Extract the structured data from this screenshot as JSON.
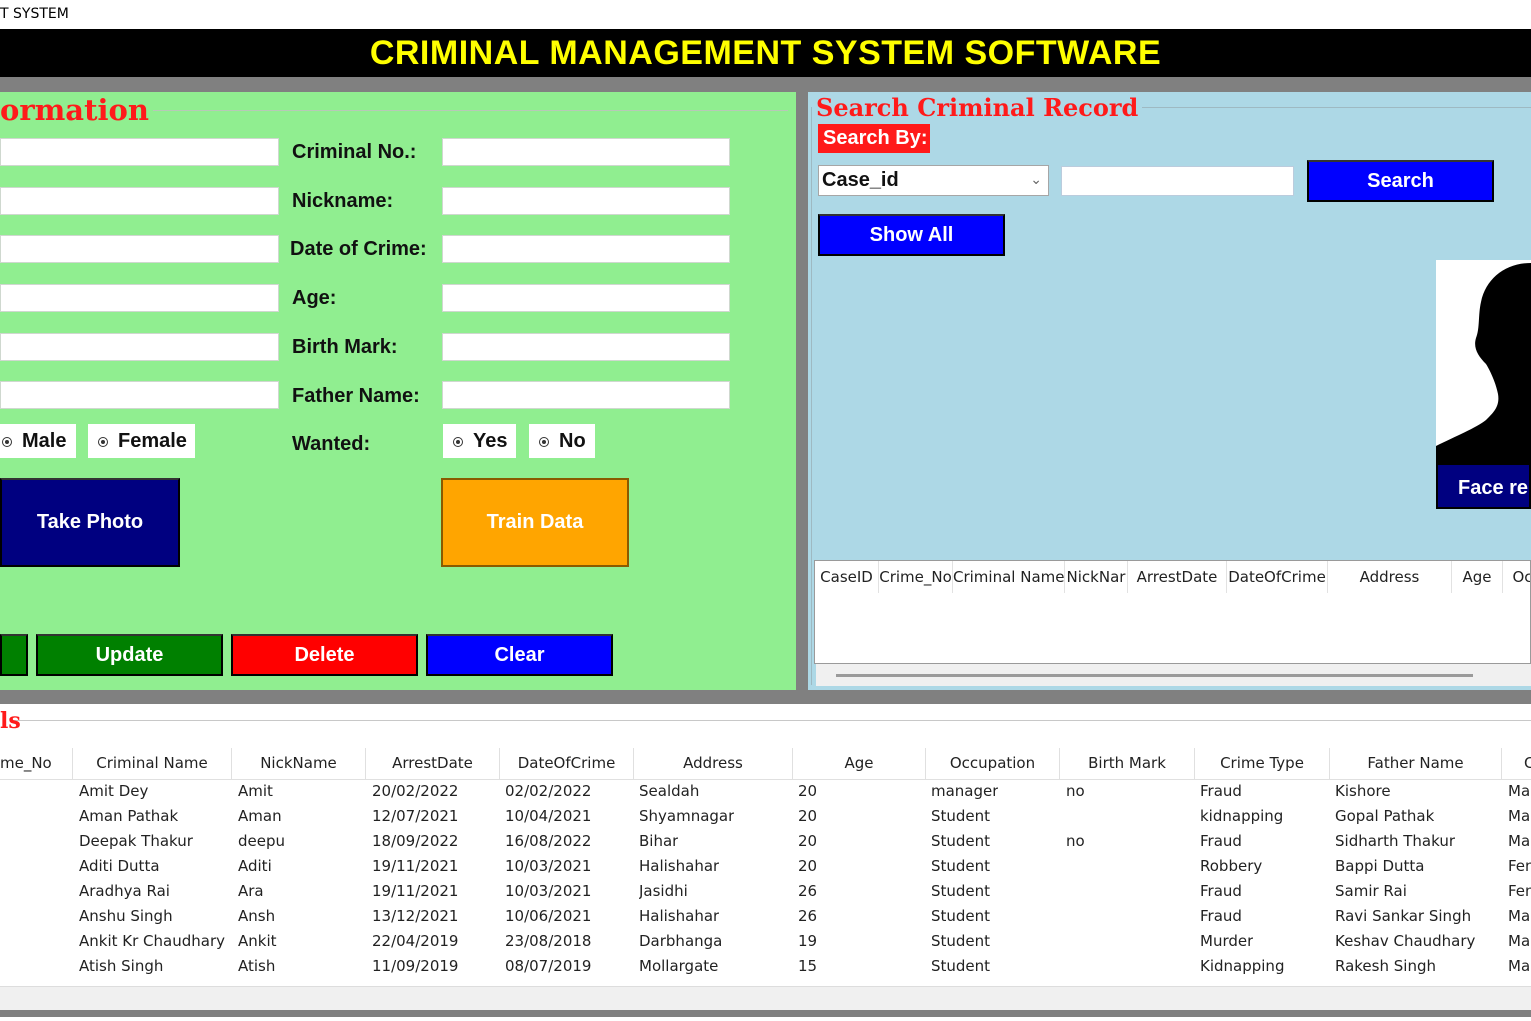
{
  "window": {
    "title": "T SYSTEM"
  },
  "banner": {
    "title": "CRIMINAL MANAGEMENT SYSTEM SOFTWARE"
  },
  "info_panel": {
    "legend": "ormation",
    "fields": {
      "criminal_no": "Criminal No.:",
      "nickname": "Nickname:",
      "date_of_crime": "Date of Crime:",
      "age": "Age:",
      "birth_mark": "Birth Mark:",
      "father_name": "Father Name:",
      "wanted": "Wanted:"
    },
    "gender": {
      "male": "Male",
      "female": "Female"
    },
    "wanted_opts": {
      "yes": "Yes",
      "no": "No"
    },
    "buttons": {
      "take_photo": "Take Photo",
      "train_data": "Train Data",
      "update": "Update",
      "delete": "Delete",
      "clear": "Clear"
    }
  },
  "search_panel": {
    "legend": "Search Criminal Record",
    "search_by": "Search By:",
    "combo_value": "Case_id",
    "search_button": "Search",
    "show_all_button": "Show All",
    "face_button": "Face re",
    "columns": [
      "CaseID",
      "Crime_No",
      "Criminal Name",
      "NickNar",
      "ArrestDate",
      "DateOfCrime",
      "Address",
      "Age",
      "Oc"
    ]
  },
  "details": {
    "legend": "ls",
    "columns": [
      "me_No",
      "Criminal Name",
      "NickName",
      "ArrestDate",
      "DateOfCrime",
      "Address",
      "Age",
      "Occupation",
      "Birth Mark",
      "Crime Type",
      "Father Name",
      "C"
    ],
    "rows": [
      [
        "",
        "Amit Dey",
        "Amit",
        "20/02/2022",
        "02/02/2022",
        "Sealdah",
        "20",
        "manager",
        "no",
        "Fraud",
        "Kishore",
        "Mal"
      ],
      [
        "",
        "Aman Pathak",
        "Aman",
        "12/07/2021",
        "10/04/2021",
        "Shyamnagar",
        "20",
        "Student",
        "",
        "kidnapping",
        "Gopal Pathak",
        "Mal"
      ],
      [
        "",
        "Deepak Thakur",
        "deepu",
        "18/09/2022",
        "16/08/2022",
        "Bihar",
        "20",
        "Student",
        "no",
        "Fraud",
        "Sidharth Thakur",
        "Mal"
      ],
      [
        "",
        "Aditi Dutta",
        "Aditi",
        "19/11/2021",
        "10/03/2021",
        "Halishahar",
        "20",
        "Student",
        "",
        "Robbery",
        "Bappi Dutta",
        "Fen"
      ],
      [
        "",
        "Aradhya Rai",
        "Ara",
        "19/11/2021",
        "10/03/2021",
        "Jasidhi",
        "26",
        "Student",
        "",
        "Fraud",
        "Samir Rai",
        "Fen"
      ],
      [
        "",
        "Anshu Singh",
        "Ansh",
        "13/12/2021",
        "10/06/2021",
        "Halishahar",
        "26",
        "Student",
        "",
        "Fraud",
        "Ravi Sankar Singh",
        "Mal"
      ],
      [
        "",
        "Ankit Kr Chaudhary",
        "Ankit",
        "22/04/2019",
        "23/08/2018",
        "Darbhanga",
        "19",
        "Student",
        "",
        "Murder",
        "Keshav Chaudhary",
        "Mal"
      ],
      [
        "",
        "Atish Singh",
        "Atish",
        "11/09/2019",
        "08/07/2019",
        "Mollargate",
        "15",
        "Student",
        "",
        "Kidnapping",
        "Rakesh Singh",
        "Mal"
      ]
    ]
  },
  "colors": {
    "banner_bg": "#000000",
    "banner_text": "#ffff00",
    "left_panel": "#90ee90",
    "right_panel": "#add8e6",
    "legend_red": "#ff1a1a",
    "navy": "#000080",
    "orange": "#ffa500",
    "green": "#008000",
    "red": "#ff0000",
    "blue": "#0000ff"
  }
}
